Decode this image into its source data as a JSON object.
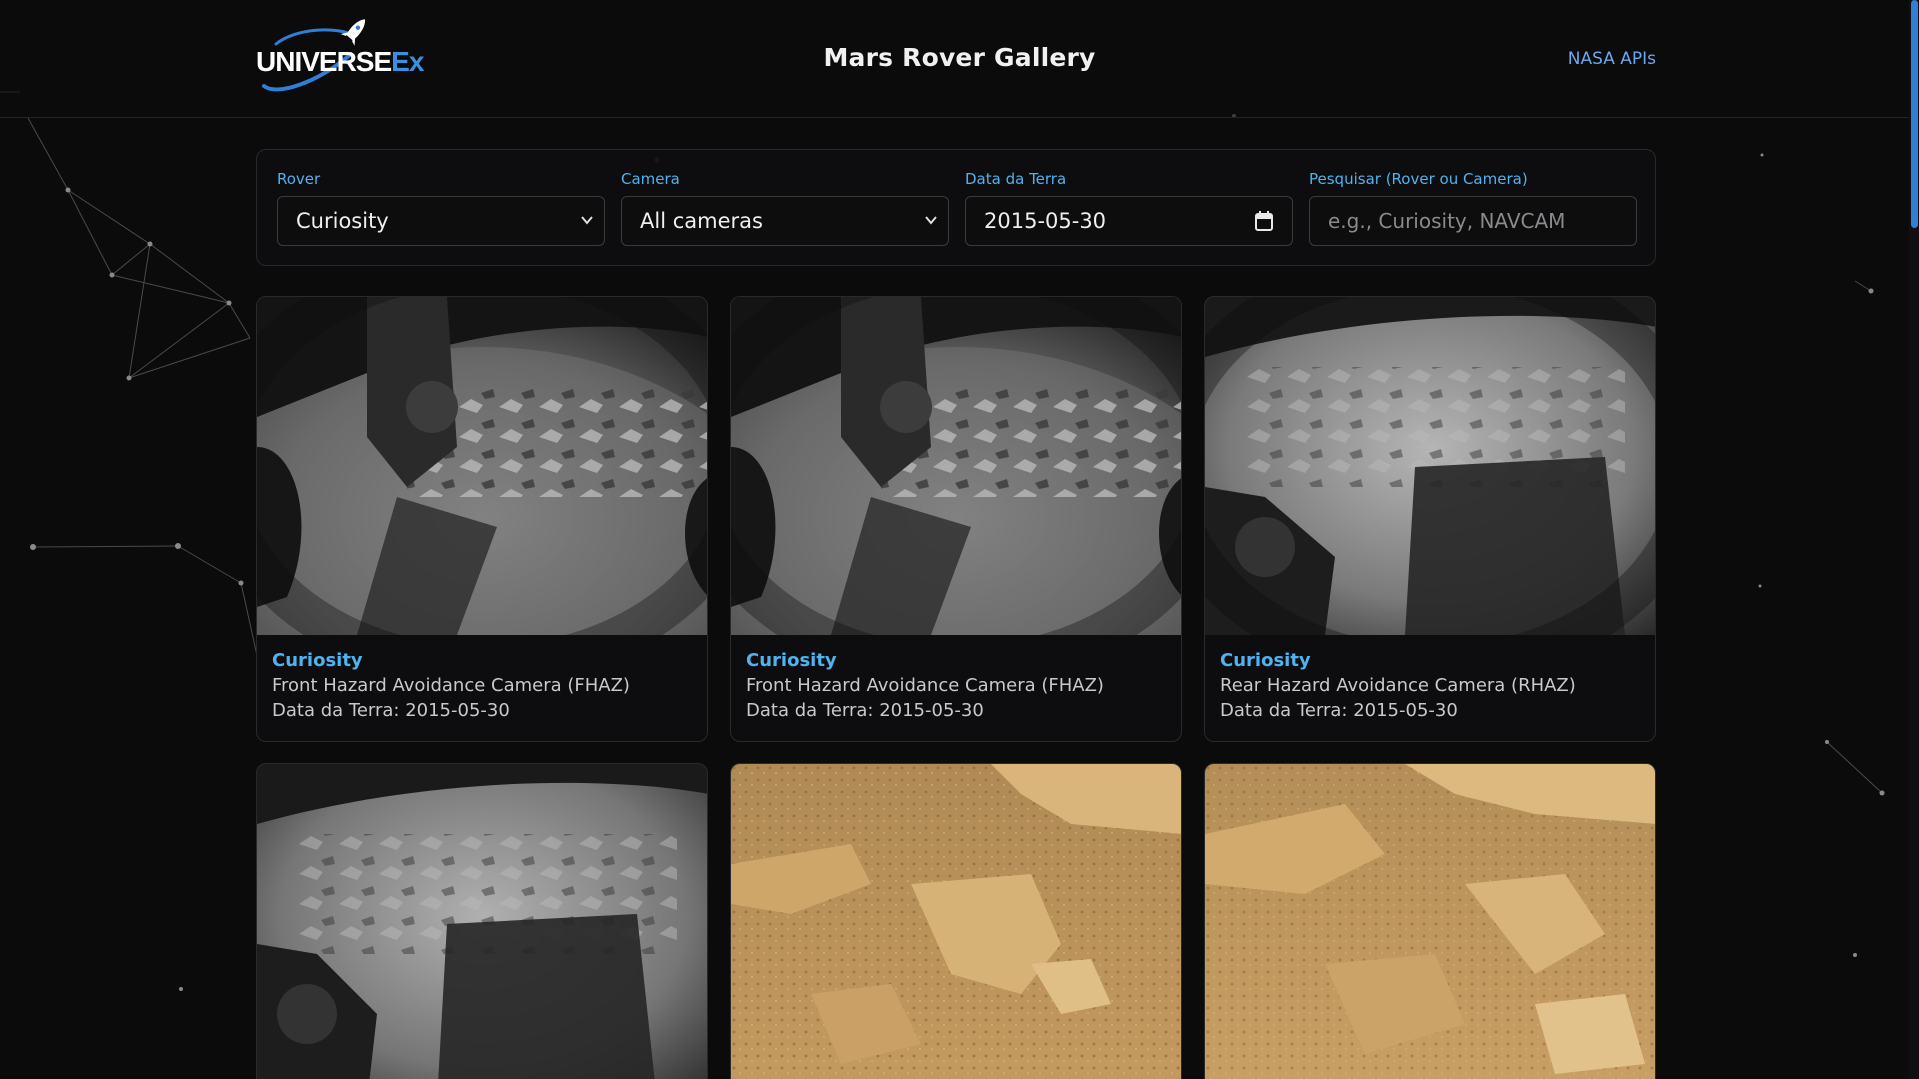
{
  "header": {
    "logo_text_main": "UNIVERSE",
    "logo_text_accent": "Ex",
    "title": "Mars Rover Gallery",
    "nav_link": "NASA APIs"
  },
  "filters": {
    "rover": {
      "label": "Rover",
      "value": "Curiosity"
    },
    "camera": {
      "label": "Camera",
      "value": "All cameras"
    },
    "earth_date": {
      "label": "Data da Terra",
      "value": "2015-05-30"
    },
    "search": {
      "label": "Pesquisar (Rover ou Camera)",
      "placeholder": "e.g., Curiosity, NAVCAM"
    }
  },
  "photos": [
    {
      "rover": "Curiosity",
      "camera": "Front Hazard Avoidance Camera (FHAZ)",
      "date": "Data da Terra: 2015-05-30",
      "tone": "gray"
    },
    {
      "rover": "Curiosity",
      "camera": "Front Hazard Avoidance Camera (FHAZ)",
      "date": "Data da Terra: 2015-05-30",
      "tone": "gray"
    },
    {
      "rover": "Curiosity",
      "camera": "Rear Hazard Avoidance Camera (RHAZ)",
      "date": "Data da Terra: 2015-05-30",
      "tone": "gray"
    },
    {
      "tone": "gray"
    },
    {
      "tone": "sand"
    },
    {
      "tone": "sand"
    }
  ],
  "colors": {
    "accent": "#4fb3ef",
    "link": "#6aa9ee",
    "background": "#0b0b0c"
  }
}
